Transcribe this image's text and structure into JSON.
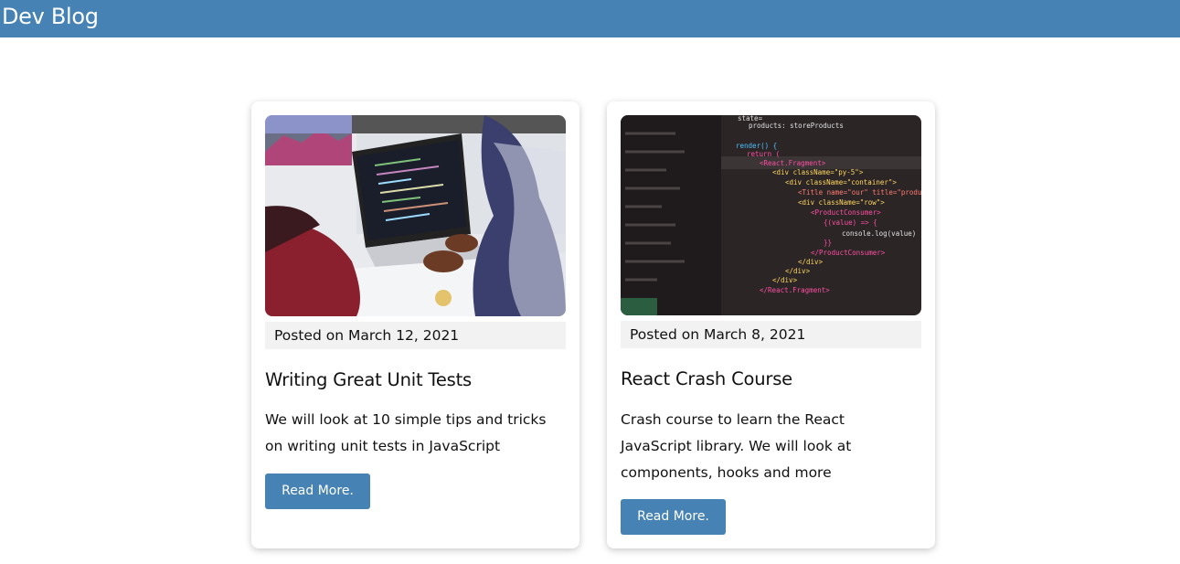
{
  "navbar": {
    "brand": "Dev Blog"
  },
  "posts": [
    {
      "image": "laptop-coding-photo",
      "date": "Posted on March 12, 2021",
      "title": "Writing Great Unit Tests",
      "description": "We will look at 10 simple tips and tricks on writing unit tests in JavaScript",
      "button": "Read More."
    },
    {
      "image": "react-code-screen-photo",
      "date": "Posted on March 8, 2021",
      "title": "React Crash Course",
      "description": "Crash course to learn the React JavaScript library. We will look at components, hooks and more",
      "button": "Read More."
    }
  ],
  "colors": {
    "accent": "#4682b4",
    "date_background": "#f2f2f2"
  }
}
